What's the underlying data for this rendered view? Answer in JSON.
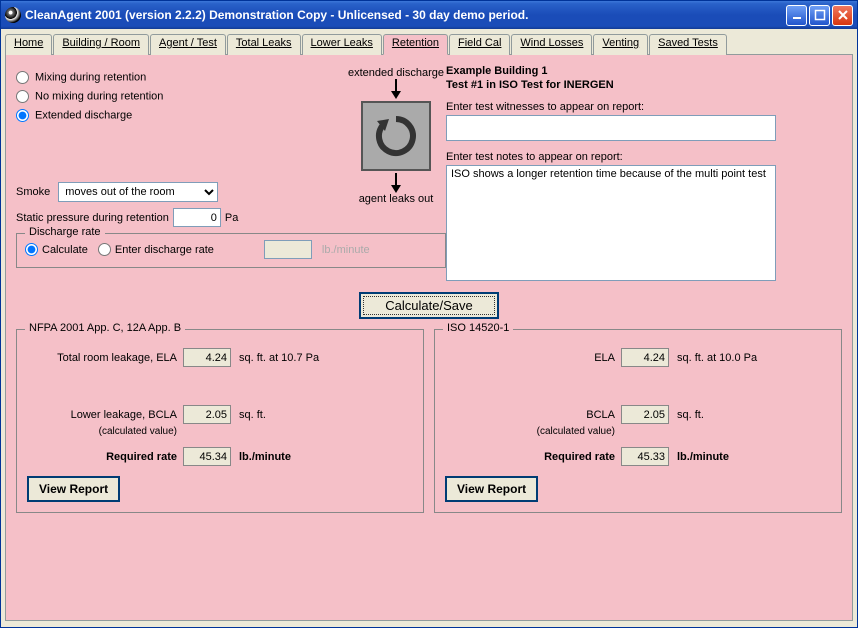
{
  "window": {
    "title": "CleanAgent 2001 (version 2.2.2) Demonstration Copy - Unlicensed - 30 day demo period."
  },
  "tabs": [
    "Home",
    "Building / Room",
    "Agent / Test",
    "Total Leaks",
    "Lower Leaks",
    "Retention",
    "Field Cal",
    "Wind Losses",
    "Venting",
    "Saved Tests"
  ],
  "retention": {
    "options": {
      "mixing": "Mixing during retention",
      "nomixing": "No mixing during retention",
      "extended": "Extended discharge"
    },
    "diagram": {
      "top": "extended discharge",
      "bottom": "agent leaks out"
    },
    "smoke": {
      "label": "Smoke",
      "value": "moves out of the room"
    },
    "static": {
      "label": "Static pressure during retention",
      "value": "0",
      "unit": "Pa"
    },
    "discharge": {
      "legend": "Discharge rate",
      "calc": "Calculate",
      "enter": "Enter discharge rate",
      "value": "",
      "unit": "lb./minute"
    },
    "info": {
      "line1": "Example Building 1",
      "line2": "Test #1 in ISO Test for INERGEN",
      "witness_label": "Enter test witnesses to appear on report:",
      "witness_value": "",
      "notes_label": "Enter test notes to appear on report:",
      "notes_value": "ISO shows a longer retention time because of the multi point test"
    },
    "calc_button": "Calculate/Save"
  },
  "results": {
    "nfpa": {
      "legend": "NFPA 2001 App. C, 12A App. B",
      "ela_label": "Total room leakage, ELA",
      "ela_value": "4.24",
      "ela_units": "sq. ft.   at 10.7 Pa",
      "bcla_label": "Lower leakage, BCLA",
      "bcla_sub": "(calculated value)",
      "bcla_value": "2.05",
      "bcla_units": "sq. ft.",
      "rate_label": "Required rate",
      "rate_value": "45.34",
      "rate_units": "lb./minute",
      "view": "View Report"
    },
    "iso": {
      "legend": "ISO 14520-1",
      "ela_label": "ELA",
      "ela_value": "4.24",
      "ela_units": "sq. ft.   at 10.0 Pa",
      "bcla_label": "BCLA",
      "bcla_sub": "(calculated value)",
      "bcla_value": "2.05",
      "bcla_units": "sq. ft.",
      "rate_label": "Required rate",
      "rate_value": "45.33",
      "rate_units": "lb./minute",
      "view": "View Report"
    }
  }
}
